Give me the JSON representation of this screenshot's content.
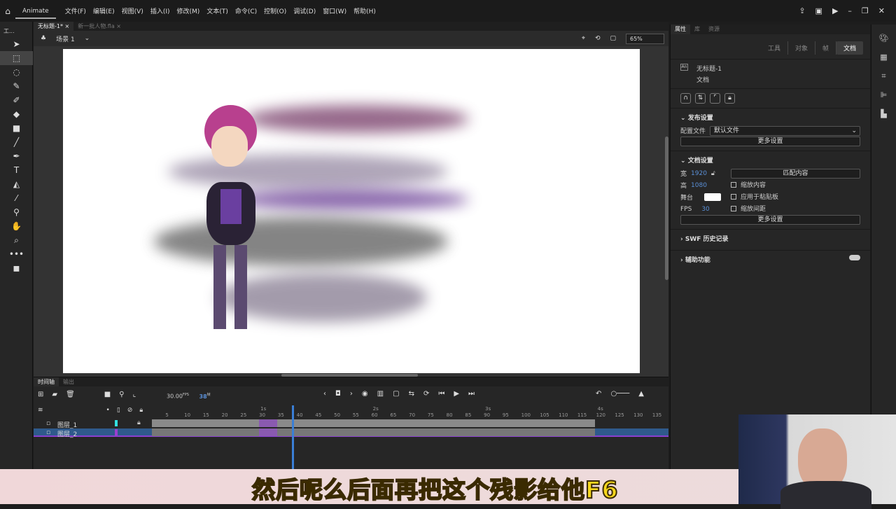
{
  "app": {
    "name": "Animate",
    "menus": [
      "文件(F)",
      "编辑(E)",
      "视图(V)",
      "插入(I)",
      "修改(M)",
      "文本(T)",
      "命令(C)",
      "控制(O)",
      "调试(D)",
      "窗口(W)",
      "帮助(H)"
    ]
  },
  "doc_tabs": [
    {
      "label": "无标题-1*"
    },
    {
      "label": "新一批人物.fla"
    }
  ],
  "scene": {
    "label": "场景 1",
    "zoom": "65%"
  },
  "tools_label": "工...",
  "properties": {
    "tabs": [
      "属性",
      "库",
      "资源"
    ],
    "segments": [
      "工具",
      "对象",
      "帧",
      "文档"
    ],
    "doc_name": "无标题-1",
    "doc_type": "文档",
    "publish": {
      "header": "发布设置",
      "profile_label": "配置文件",
      "profile_value": "默认文件",
      "more": "更多设置"
    },
    "docsettings": {
      "header": "文档设置",
      "width_label": "宽",
      "width": "1920",
      "height_label": "高",
      "height": "1080",
      "stage_label": "舞台",
      "stage_color": "#ffffff",
      "fps_label": "FPS",
      "fps": "30",
      "match": "匹配内容",
      "scale_content": "缩放内容",
      "apply_paste": "应用于粘贴板",
      "scale_spacing": "缩放间距",
      "more": "更多设置"
    },
    "swf": "SWF 历史记录",
    "accessibility": "辅助功能"
  },
  "timeline": {
    "tabs": [
      "时间轴",
      "输出"
    ],
    "fps": "30.00",
    "fps_unit": "FPS",
    "frame": "38",
    "frame_unit": "帧",
    "current_frame": 38,
    "ruler": [
      "5",
      "10",
      "15",
      "20",
      "25",
      "30",
      "35",
      "40",
      "45",
      "50",
      "55",
      "60",
      "65",
      "70",
      "75",
      "80",
      "85",
      "90",
      "95",
      "100",
      "105",
      "110",
      "115",
      "120",
      "125",
      "130",
      "135"
    ],
    "seconds": [
      "1s",
      "2s",
      "3s",
      "4s"
    ],
    "layers": [
      {
        "name": "图层_1",
        "color": "#33e0e0",
        "locked": true
      },
      {
        "name": "图层_2",
        "color": "#9a3fd0",
        "selected": true
      }
    ]
  },
  "subtitle": "然后呢么后面再把这个残影给他F6"
}
